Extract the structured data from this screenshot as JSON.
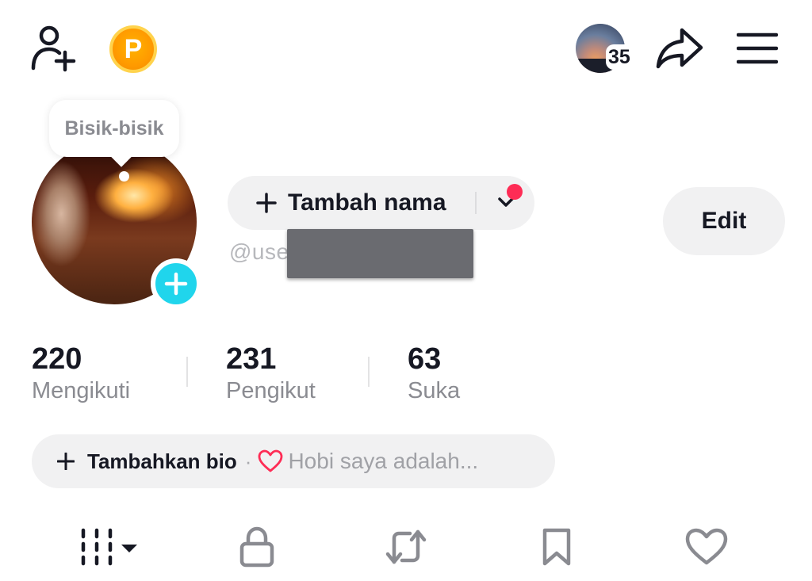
{
  "header": {
    "coin_letter": "P",
    "story_count": "35"
  },
  "tooltip": {
    "text": "Bisik-bisik"
  },
  "profile": {
    "name_button_label": "Tambah nama",
    "username_prefix": "@use",
    "edit_label": "Edit"
  },
  "stats": [
    {
      "value": "220",
      "label": "Mengikuti"
    },
    {
      "value": "231",
      "label": "Pengikut"
    },
    {
      "value": "63",
      "label": "Suka"
    }
  ],
  "bio": {
    "add_label": "Tambahkan bio",
    "separator": "·",
    "hint": "Hobi saya adalah..."
  },
  "tabs": [
    {
      "icon": "videos-grid-icon"
    },
    {
      "icon": "lock-icon"
    },
    {
      "icon": "repost-icon"
    },
    {
      "icon": "bookmark-icon"
    },
    {
      "icon": "heart-icon"
    }
  ],
  "colors": {
    "accent_red": "#fe2c55",
    "accent_cyan": "#20d5ec",
    "coin_orange": "#ff9a00",
    "pill_bg": "#f1f1f2"
  }
}
